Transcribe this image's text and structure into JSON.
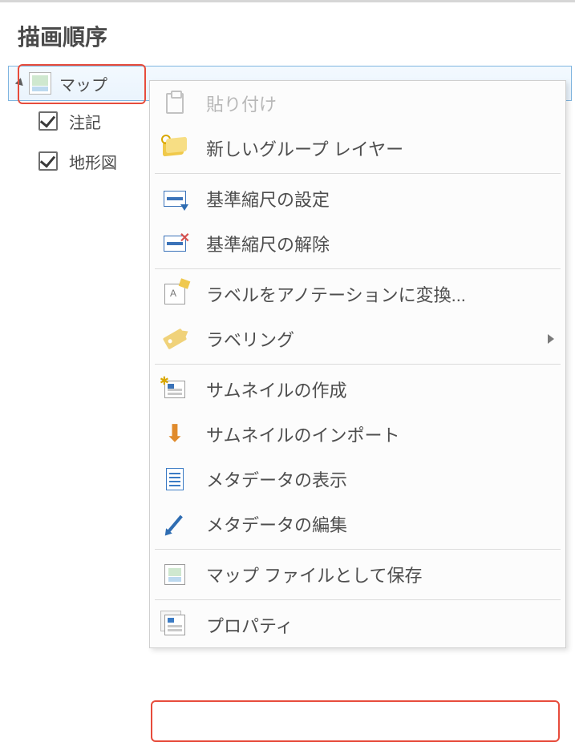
{
  "panel": {
    "title": "描画順序"
  },
  "tree": {
    "map_label": "マップ",
    "children": [
      {
        "label": "注記",
        "checked": true
      },
      {
        "label": "地形図",
        "checked": true
      }
    ]
  },
  "menu": {
    "paste": "貼り付け",
    "new_group_layer": "新しいグループ レイヤー",
    "set_ref_scale": "基準縮尺の設定",
    "clear_ref_scale": "基準縮尺の解除",
    "labels_to_anno": "ラベルをアノテーションに変換...",
    "labeling": "ラベリング",
    "create_thumbnail": "サムネイルの作成",
    "import_thumbnail": "サムネイルのインポート",
    "view_metadata": "メタデータの表示",
    "edit_metadata": "メタデータの編集",
    "save_as_map_file": "マップ ファイルとして保存",
    "properties": "プロパティ"
  }
}
